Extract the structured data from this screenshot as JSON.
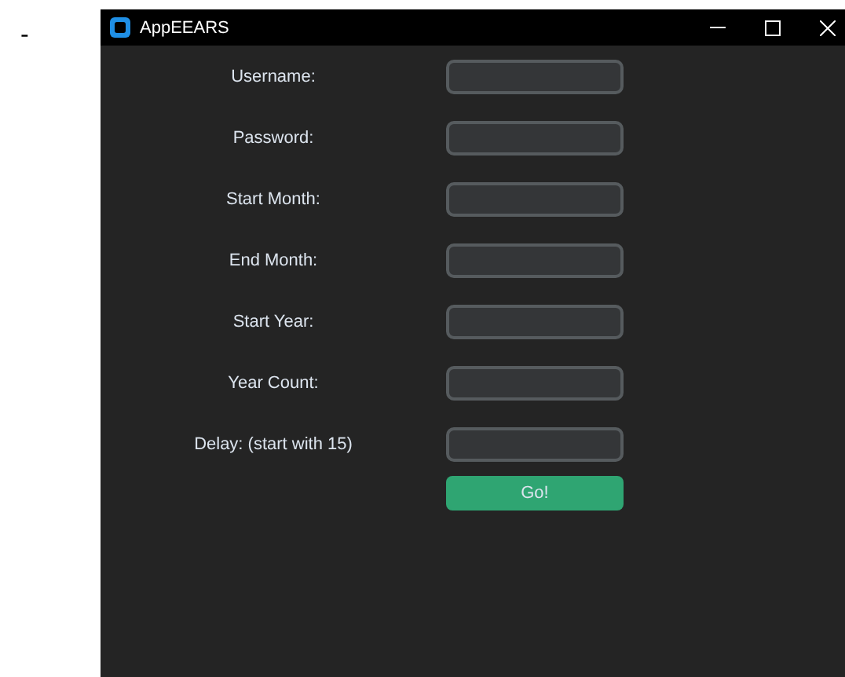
{
  "page": {
    "mark": "-"
  },
  "window": {
    "title": "AppEEARS",
    "controls": [
      {
        "kind": "minimize"
      },
      {
        "kind": "maximize"
      },
      {
        "kind": "close"
      }
    ]
  },
  "form": {
    "fields": [
      {
        "label": "Username:"
      },
      {
        "label": "Password:"
      },
      {
        "label": "Start Month:"
      },
      {
        "label": "End Month:"
      },
      {
        "label": "Start Year:"
      },
      {
        "label": "Year Count:"
      },
      {
        "label": "Delay: (start with 15)"
      }
    ],
    "button": "Go!"
  }
}
